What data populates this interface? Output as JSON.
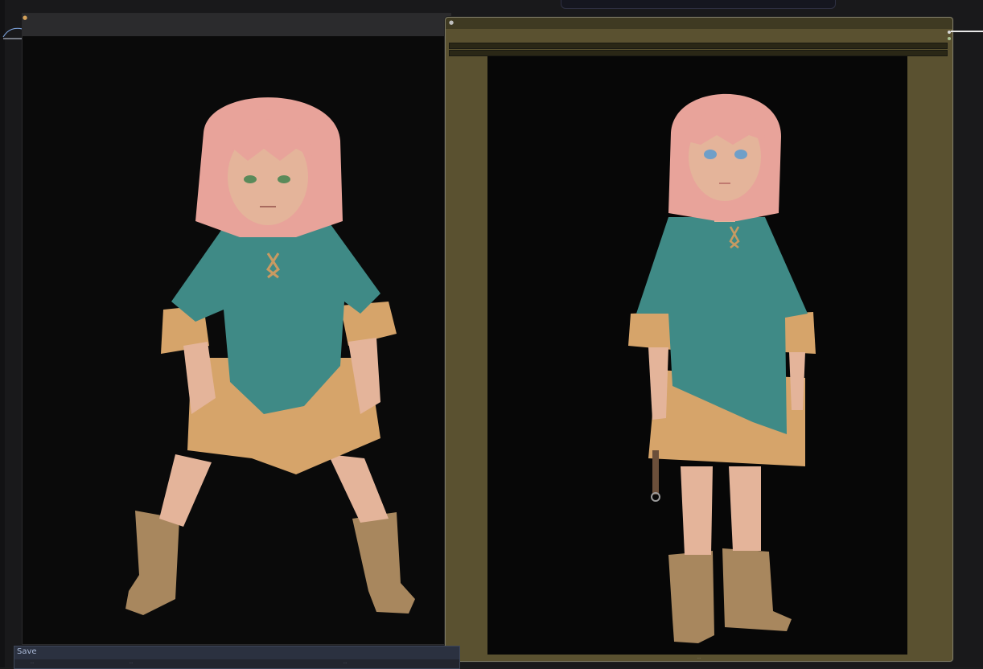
{
  "app": {
    "background": "#19191b"
  },
  "left_node": {
    "image_description": "pink-haired child in teal tunic and tan skirt, crouched stance, black background"
  },
  "right_node": {
    "accent": "#5a5130",
    "caption": "…",
    "image_description": "pink-haired child in teal tunic and tan skirt, standing, black background"
  },
  "save_node": {
    "title": "Save",
    "values": [
      "…",
      "…",
      "…"
    ]
  },
  "colors": {
    "hair": "#e8a39a",
    "tunic": "#3f8a86",
    "skirt": "#d6a46a",
    "boots": "#a8875e",
    "skin": "#e4b49a",
    "olive": "#5a5130",
    "save_bar": "#2b3140"
  }
}
